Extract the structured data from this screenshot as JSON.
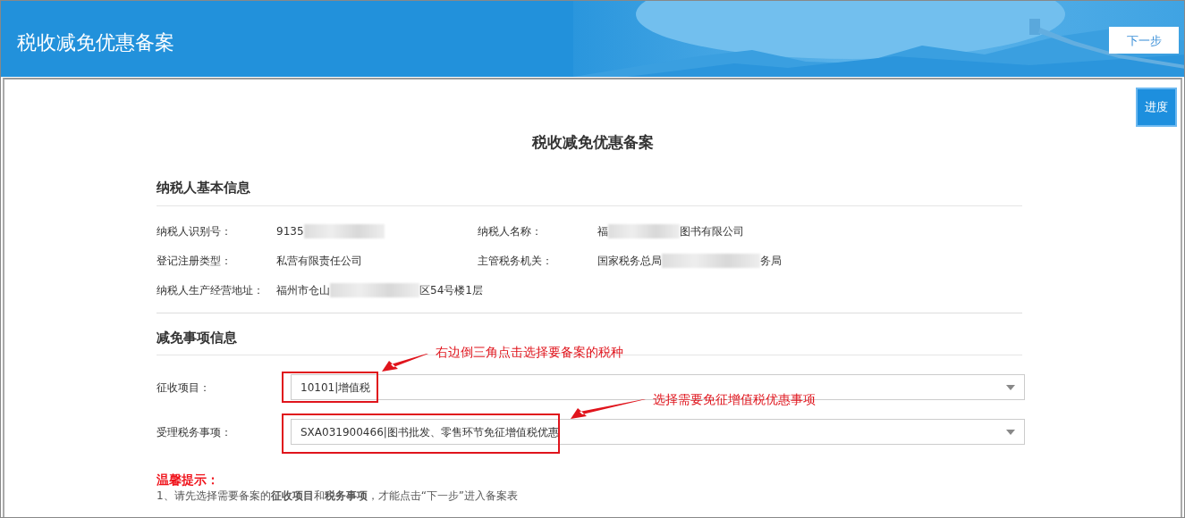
{
  "header": {
    "title": "税收减免优惠备案",
    "next_button": "下一步"
  },
  "progress_button": "进度",
  "page_title": "税收减免优惠备案",
  "taxpayer_section": {
    "heading": "纳税人基本信息",
    "rows": [
      [
        {
          "label": "纳税人识别号：",
          "value": [
            {
              "text": "9135"
            },
            {
              "kind": "redacted"
            }
          ]
        },
        {
          "label": "纳税人名称：",
          "value": [
            {
              "text": "福"
            },
            {
              "kind": "redacted"
            },
            {
              "text": "图书有限公司"
            }
          ]
        }
      ],
      [
        {
          "label": "登记注册类型：",
          "value": [
            {
              "text": "私营有限责任公司"
            }
          ]
        },
        {
          "label": "主管税务机关：",
          "value": [
            {
              "text": "国家税务总局"
            },
            {
              "kind": "redacted"
            },
            {
              "text": "务局"
            }
          ]
        }
      ],
      [
        {
          "label": "纳税人生产经营地址：",
          "value": [
            {
              "text": "福州市仓山"
            },
            {
              "kind": "redacted"
            },
            {
              "text": "区54号楼1层"
            }
          ]
        }
      ]
    ]
  },
  "exemption_section": {
    "heading": "减免事项信息",
    "selects": [
      {
        "label": "征收项目：",
        "value": "10101|增值税"
      },
      {
        "label": "受理税务事项：",
        "value": "SXA031900466|图书批发、零售环节免征增值税优惠"
      }
    ]
  },
  "annotations": [
    {
      "text": "右边倒三角点击选择要备案的税种"
    },
    {
      "text": "选择需要免征增值税优惠事项"
    }
  ],
  "tips": {
    "heading": "温馨提示：",
    "items": [
      "1、请先选择需要备案的**征收项目**和**税务事项**，才能点击“下一步”进入备案表"
    ]
  }
}
